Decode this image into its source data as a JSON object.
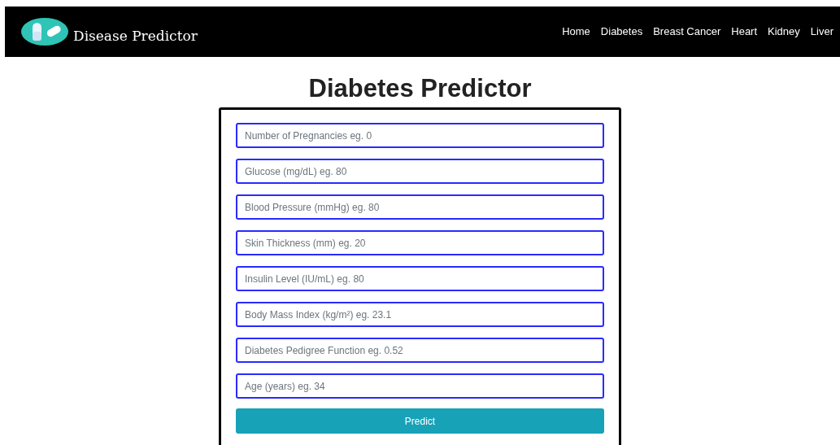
{
  "navbar": {
    "brand": "Disease Predictor",
    "links": [
      {
        "label": "Home"
      },
      {
        "label": "Diabetes"
      },
      {
        "label": "Breast Cancer"
      },
      {
        "label": "Heart"
      },
      {
        "label": "Kidney"
      },
      {
        "label": "Liver"
      }
    ]
  },
  "heading": "Diabetes Predictor",
  "fields": [
    {
      "placeholder": "Number of Pregnancies eg. 0"
    },
    {
      "placeholder": "Glucose (mg/dL) eg. 80"
    },
    {
      "placeholder": "Blood Pressure (mmHg) eg. 80"
    },
    {
      "placeholder": "Skin Thickness (mm) eg. 20"
    },
    {
      "placeholder": "Insulin Level (IU/mL) eg. 80"
    },
    {
      "placeholder": "Body Mass Index (kg/m²) eg. 23.1"
    },
    {
      "placeholder": "Diabetes Pedigree Function eg. 0.52"
    },
    {
      "placeholder": "Age (years) eg. 34"
    }
  ],
  "button": "Predict"
}
